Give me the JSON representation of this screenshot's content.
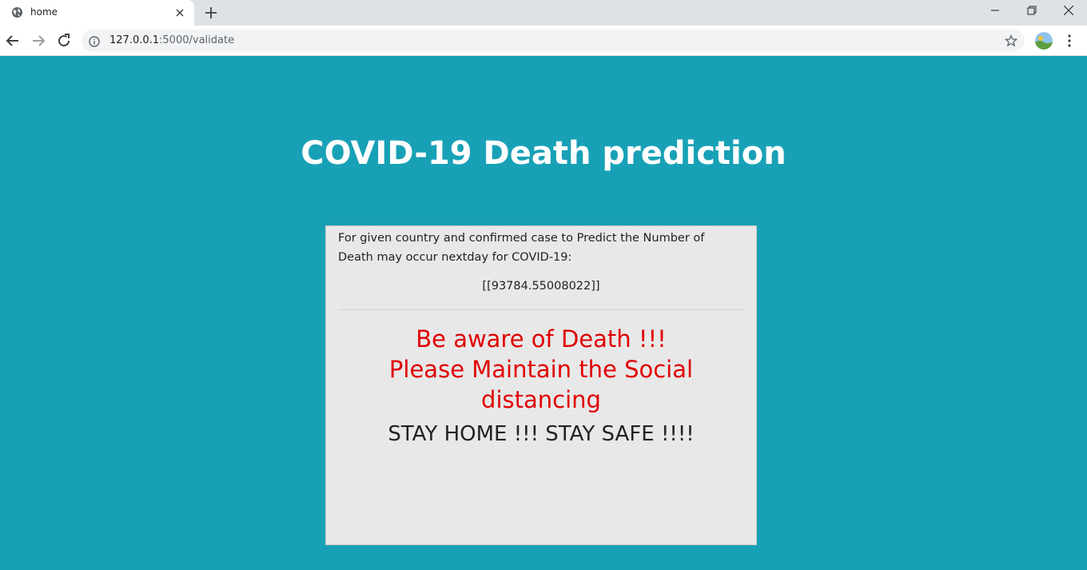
{
  "browser": {
    "tab": {
      "title": "home"
    },
    "address_bar": {
      "host": "127.0.0.1",
      "path": ":5000/validate"
    }
  },
  "page": {
    "title": "COVID-19 Death prediction",
    "card": {
      "description": "For given country and confirmed case to Predict the Number of Death may occur nextday for COVID-19:",
      "result": "[[93784.55008022]]",
      "warning_line1": "Be aware of Death !!!",
      "warning_line2": "Please Maintain the Social distancing",
      "stay_message": "STAY HOME !!! STAY SAFE !!!!"
    }
  },
  "colors": {
    "page_background": "#18a1b6",
    "card_background": "#e8e8e8",
    "warning_text": "#e00000",
    "title_text": "#ffffff"
  },
  "icons": [
    "globe-icon",
    "close-icon",
    "plus-icon",
    "minimize-icon",
    "restore-icon",
    "window-close-icon",
    "back-arrow-icon",
    "forward-arrow-icon",
    "reload-icon",
    "info-icon",
    "star-icon",
    "avatar",
    "kebab-menu-icon"
  ]
}
